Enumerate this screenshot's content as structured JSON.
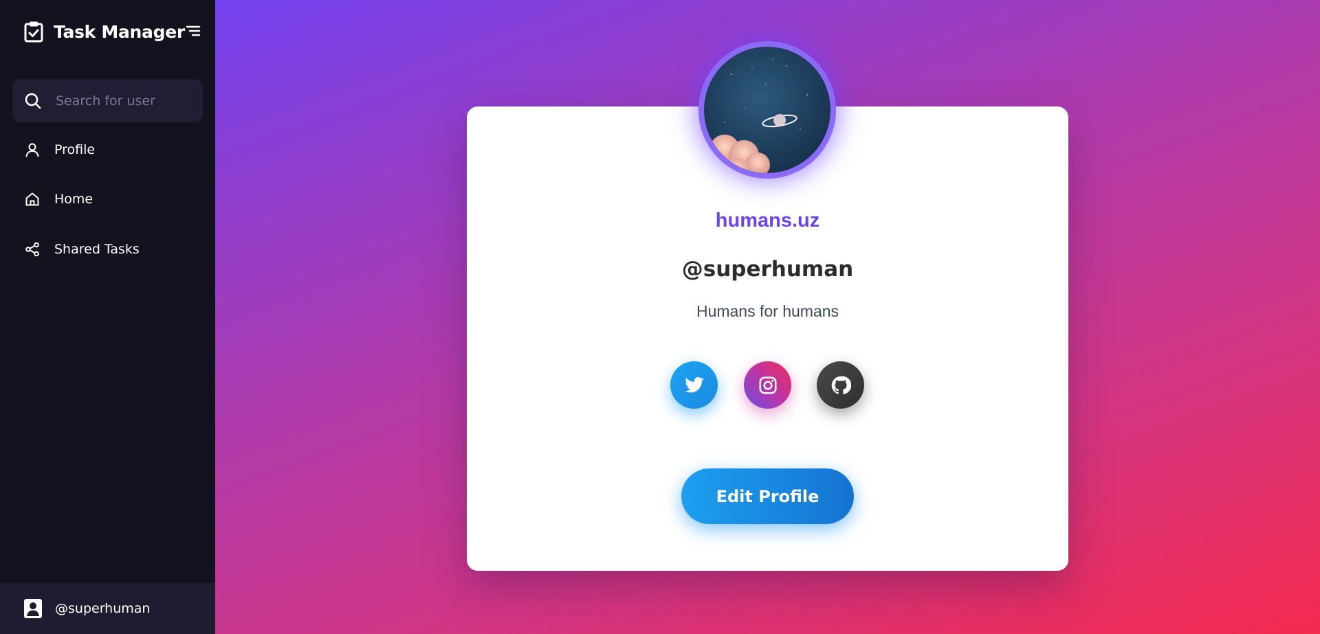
{
  "app": {
    "title": "Task Manager"
  },
  "search": {
    "placeholder": "Search for user"
  },
  "nav": [
    {
      "label": "Profile",
      "icon": "user-icon"
    },
    {
      "label": "Home",
      "icon": "home-icon"
    },
    {
      "label": "Shared Tasks",
      "icon": "share-icon"
    }
  ],
  "footer": {
    "username": "@superhuman"
  },
  "profile": {
    "site": "humans.uz",
    "handle": "@superhuman",
    "bio": "Humans for humans",
    "edit_label": "Edit Profile",
    "social": [
      "twitter-icon",
      "instagram-icon",
      "github-icon"
    ]
  },
  "colors": {
    "sidebar": "#13131f",
    "accent": "#6a45f0",
    "twitter": "#1da1f2",
    "button": "#1d9ff0"
  }
}
